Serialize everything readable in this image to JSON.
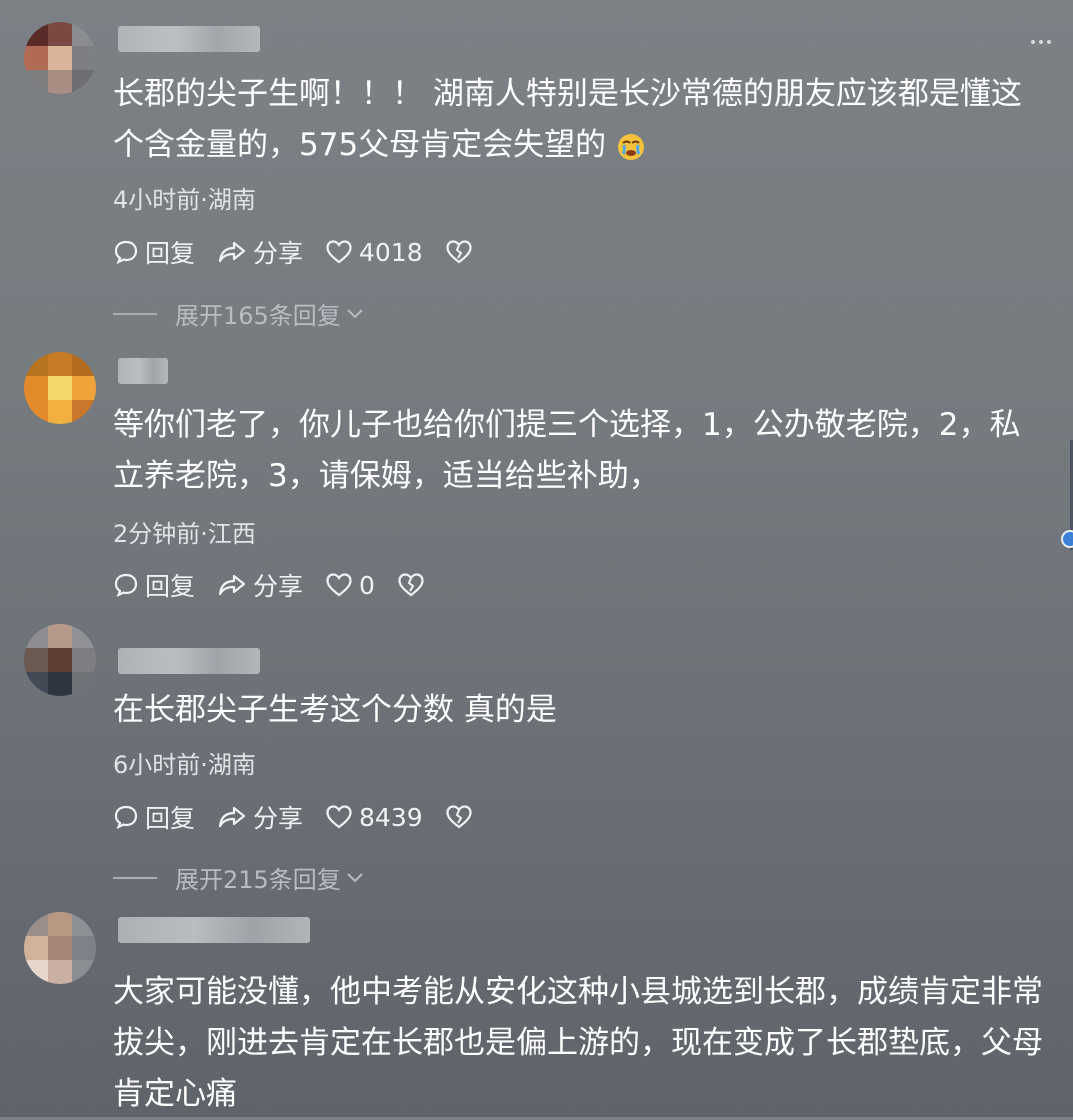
{
  "comments": [
    {
      "text": "长郡的尖子生啊！！！ 湖南人特别是长沙常德的朋友应该都是懂这个含金量的，575父母肯定会失望的",
      "meta": "4小时前·湖南",
      "reply_label": "回复",
      "share_label": "分享",
      "likes": "4018",
      "expand_label": "展开165条回复"
    },
    {
      "text": "等你们老了，你儿子也给你们提三个选择，1，公办敬老院，2，私立养老院，3，请保姆，适当给些补助，",
      "meta": "2分钟前·江西",
      "reply_label": "回复",
      "share_label": "分享",
      "likes": "0"
    },
    {
      "text": "在长郡尖子生考这个分数 真的是",
      "meta": "6小时前·湖南",
      "reply_label": "回复",
      "share_label": "分享",
      "likes": "8439",
      "expand_label": "展开215条回复"
    },
    {
      "text": "大家可能没懂，他中考能从安化这种小县城选到长郡，成绩肯定非常拔尖，刚进去肯定在长郡也是偏上游的，现在变成了长郡垫底，父母肯定心痛"
    }
  ],
  "icons": {
    "reply": "comment-bubble-icon",
    "share": "share-arrow-icon",
    "like": "heart-icon",
    "dislike": "broken-heart-icon",
    "more": "more-dots-icon",
    "emoji": "crying-face-emoji"
  },
  "colors": {
    "text": "#ffffff",
    "meta": "#e1e3e6",
    "muted": "#b9bdc2"
  }
}
